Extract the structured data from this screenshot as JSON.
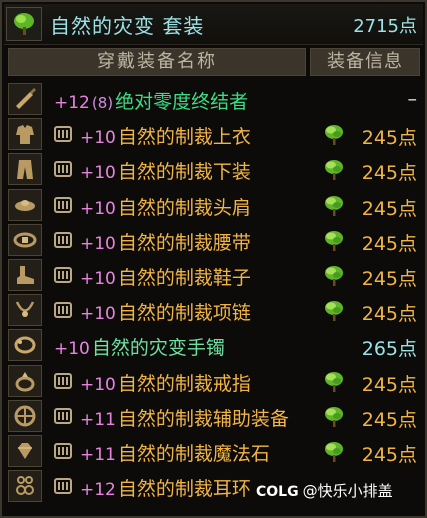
{
  "set": {
    "title": "自然的灾变 套装",
    "score": "2715点"
  },
  "headers": {
    "name": "穿戴装备名称",
    "info": "装备信息"
  },
  "items": [
    {
      "slot_icon": "weapon-icon",
      "plus": "+12",
      "tune": "(8)",
      "name": "绝对零度终结者",
      "name_color": "#3ddc84",
      "locked": false,
      "leaf": false,
      "score": "–",
      "score_color": "#e8e2cf"
    },
    {
      "slot_icon": "top-armor-icon",
      "plus": "+10",
      "tune": "",
      "name": "自然的制裁上衣",
      "name_color": "#f2b544",
      "locked": true,
      "leaf": true,
      "score": "245点",
      "score_color": "#f2b544"
    },
    {
      "slot_icon": "pants-icon",
      "plus": "+10",
      "tune": "",
      "name": "自然的制裁下装",
      "name_color": "#f2b544",
      "locked": true,
      "leaf": true,
      "score": "245点",
      "score_color": "#f2b544"
    },
    {
      "slot_icon": "shoulder-icon",
      "plus": "+10",
      "tune": "",
      "name": "自然的制裁头肩",
      "name_color": "#f2b544",
      "locked": true,
      "leaf": true,
      "score": "245点",
      "score_color": "#f2b544"
    },
    {
      "slot_icon": "belt-icon",
      "plus": "+10",
      "tune": "",
      "name": "自然的制裁腰带",
      "name_color": "#f2b544",
      "locked": true,
      "leaf": true,
      "score": "245点",
      "score_color": "#f2b544"
    },
    {
      "slot_icon": "shoes-icon",
      "plus": "+10",
      "tune": "",
      "name": "自然的制裁鞋子",
      "name_color": "#f2b544",
      "locked": true,
      "leaf": true,
      "score": "245点",
      "score_color": "#f2b544"
    },
    {
      "slot_icon": "necklace-icon",
      "plus": "+10",
      "tune": "",
      "name": "自然的制裁项链",
      "name_color": "#f2b544",
      "locked": true,
      "leaf": true,
      "score": "245点",
      "score_color": "#f2b544"
    },
    {
      "slot_icon": "bracelet-icon",
      "plus": "+10",
      "tune": "",
      "name": "自然的灾变手镯",
      "name_color": "#6fe0a0",
      "locked": false,
      "leaf": false,
      "score": "265点",
      "score_color": "#9be3e6"
    },
    {
      "slot_icon": "ring-icon",
      "plus": "+10",
      "tune": "",
      "name": "自然的制裁戒指",
      "name_color": "#f2b544",
      "locked": true,
      "leaf": true,
      "score": "245点",
      "score_color": "#f2b544"
    },
    {
      "slot_icon": "subequip-icon",
      "plus": "+11",
      "tune": "",
      "name": "自然的制裁辅助装备",
      "name_color": "#f2b544",
      "locked": true,
      "leaf": true,
      "score": "245点",
      "score_color": "#f2b544"
    },
    {
      "slot_icon": "magic-stone-icon",
      "plus": "+11",
      "tune": "",
      "name": "自然的制裁魔法石",
      "name_color": "#f2b544",
      "locked": true,
      "leaf": true,
      "score": "245点",
      "score_color": "#f2b544"
    },
    {
      "slot_icon": "earring-icon",
      "plus": "+12",
      "tune": "",
      "name": "自然的制裁耳环",
      "name_color": "#f2b544",
      "locked": true,
      "leaf": false,
      "score": "",
      "score_color": "#f2b544"
    }
  ],
  "watermark": {
    "brand": "COLG",
    "text": "@快乐小排盖"
  },
  "colors": {
    "title_cyan": "#9be3e6",
    "plus_pink": "#e884e0",
    "orange": "#f2b544",
    "leaf_green": "#7ed23a"
  }
}
